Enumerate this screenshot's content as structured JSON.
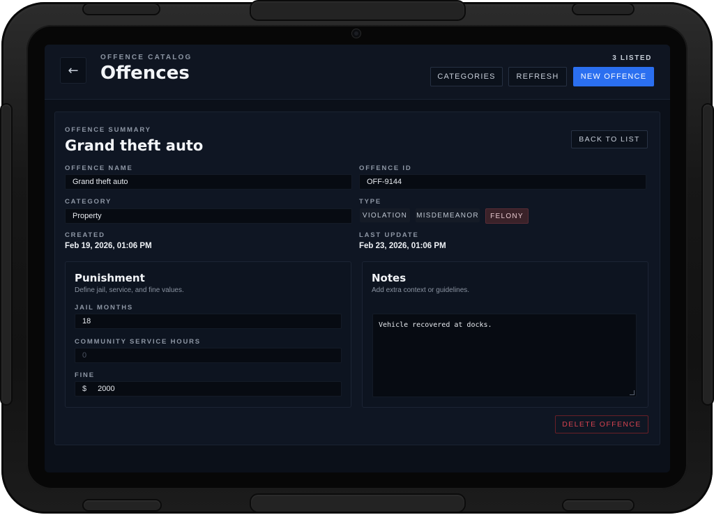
{
  "header": {
    "back_icon": "arrow-left-icon",
    "eyebrow": "OFFENCE CATALOG",
    "title": "Offences",
    "listed_count": "3 LISTED",
    "buttons": {
      "categories": "CATEGORIES",
      "refresh": "REFRESH",
      "new_offence": "NEW OFFENCE"
    },
    "accent_color": "#2b6ff0"
  },
  "summary": {
    "eyebrow": "OFFENCE SUMMARY",
    "title": "Grand theft auto",
    "back_to_list": "BACK TO LIST",
    "fields": {
      "offence_name_label": "OFFENCE NAME",
      "offence_name_value": "Grand theft auto",
      "offence_id_label": "OFFENCE ID",
      "offence_id_value": "OFF-9144",
      "category_label": "CATEGORY",
      "category_value": "Property",
      "type_label": "TYPE",
      "type_options": [
        "VIOLATION",
        "MISDEMEANOR",
        "FELONY"
      ],
      "type_selected": "FELONY",
      "created_label": "CREATED",
      "created_value": "Feb 19, 2026, 01:06 PM",
      "last_update_label": "LAST UPDATE",
      "last_update_value": "Feb 23, 2026, 01:06 PM"
    }
  },
  "punishment": {
    "title": "Punishment",
    "subtitle": "Define jail, service, and fine values.",
    "jail_label": "JAIL MONTHS",
    "jail_value": "18",
    "service_label": "COMMUNITY SERVICE HOURS",
    "service_placeholder": "0",
    "fine_label": "FINE",
    "fine_currency": "$",
    "fine_value": "2000"
  },
  "notes": {
    "title": "Notes",
    "subtitle": "Add extra context or guidelines.",
    "text": "Vehicle recovered at docks."
  },
  "actions": {
    "delete": "DELETE OFFENCE",
    "danger_color": "#d5434f"
  }
}
